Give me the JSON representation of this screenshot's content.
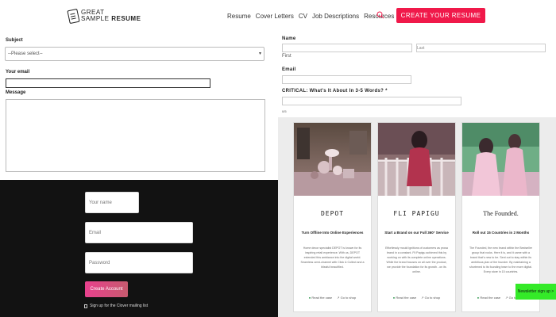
{
  "header": {
    "logo_line1": "GREAT",
    "logo_line2a": "SAMPLE",
    "logo_line2b": "RESUME",
    "nav": [
      "Resume",
      "Cover Letters",
      "CV",
      "Job Descriptions",
      "Resources"
    ],
    "cta_label": "CREATE YOUR RESUME"
  },
  "contact_form": {
    "subject_label": "Subject",
    "subject_value": "--Please select--",
    "email_label": "Your email",
    "email_value": "",
    "message_label": "Message",
    "message_value": ""
  },
  "signup": {
    "name_placeholder": "Your name",
    "email_placeholder": "Email",
    "password_placeholder": "Password",
    "button_label": "Create Account",
    "checkbox_label": "Sign up for the Clover mailing list"
  },
  "right_form": {
    "name_label": "Name",
    "first_label": "First",
    "last_label": "Last",
    "email_label": "Email",
    "critical_label": "CRITICAL: What's It About In 3-5 Words? *",
    "counter_text": "0/5"
  },
  "cards": [
    {
      "brand": "DEPOT",
      "tagline": "Turn Offline Into Online Experiences",
      "desc": "Home decor specialist DEPOT is known for its inspiring retail experience. With us, DEPOT extended this ambiance into the digital world. Seamless omni-channel with Click & Collect and a blissful beautified.",
      "link1": "Read the case",
      "link2": "Go to shop"
    },
    {
      "brand": "FLI PAPIGU",
      "tagline": "Start a Brand on our Full 360° Service",
      "desc": "Effortlessly mould ignitions of customers as prosa brand in a constant. Fli Papigu achieved this by working on with its complete online operations. While the brand focuses on all over the product, we provide the foundation for its growth - on its online.",
      "link1": "Read the case",
      "link2": "Go to shop"
    },
    {
      "brand": "The Founded.",
      "tagline": "Roll out 15 Countries in 2 Months",
      "desc": "The Founded, the new brand within the Bestseller group that rocks. Here it is, and it came with a brand that's new to be. Sent out to stay within its ambitious plan of the founder. By maintaining a shortened to its founding team to the more digital. Every store in 15 countries.",
      "link1": "Read the case",
      "link2": "Go to shop"
    }
  ],
  "newsletter_label": "Newsletter sign up >",
  "colors": {
    "accent": "#f0194a",
    "newsletter": "#34ea28",
    "dark_bg": "#121212"
  }
}
